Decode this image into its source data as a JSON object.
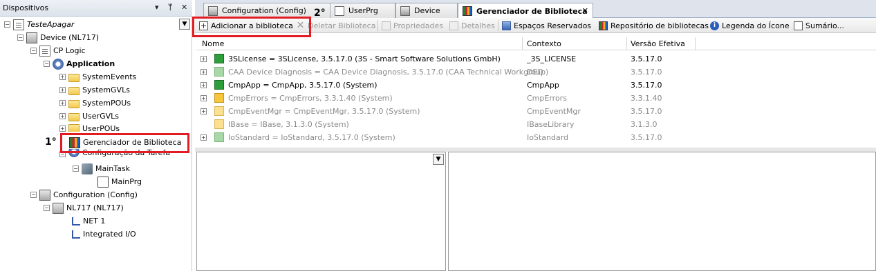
{
  "left_panel": {
    "title": "Dispositivos",
    "pin_label": "▾",
    "pin2_label": "ᛘ",
    "close_label": "✕",
    "tree": [
      {
        "label": "TesteApagar",
        "italic": true
      },
      {
        "label": "Device (NL717)"
      },
      {
        "label": "CP Logic"
      },
      {
        "label": "Application",
        "bold": true
      },
      {
        "label": "SystemEvents"
      },
      {
        "label": "SystemGVLs"
      },
      {
        "label": "SystemPOUs"
      },
      {
        "label": "UserGVLs"
      },
      {
        "label": "UserPOUs"
      },
      {
        "label": "Gerenciador de Biblioteca"
      },
      {
        "label": "Configuração da Tarefa"
      },
      {
        "label": "MainTask"
      },
      {
        "label": "MainPrg"
      },
      {
        "label": "Configuration (Config)"
      },
      {
        "label": "NL717 (NL717)"
      },
      {
        "label": "NET 1"
      },
      {
        "label": "Integrated I/O"
      }
    ],
    "step_label": "1°"
  },
  "tabs": [
    {
      "label": "Configuration (Config)"
    },
    {
      "label": "UserPrg"
    },
    {
      "label": "Device"
    },
    {
      "label": "Gerenciador de Biblioteca",
      "active": true,
      "close": "✕"
    }
  ],
  "step2_label": "2°",
  "toolbar": {
    "add_library": "Adicionar a biblioteca",
    "delete_library": "Deletar Biblioteca",
    "properties": "Propriedades",
    "details": "Detalhes",
    "placeholders": "Espaços Reservados",
    "library_repository": "Repositório de bibliotecas",
    "icon_legend": "Legenda do Ícone",
    "summary": "Sumário..."
  },
  "library_table": {
    "columns": [
      "Nome",
      "Contexto",
      "Versão Efetiva"
    ],
    "rows": [
      {
        "name": "3SLicense = 3SLicense, 3.5.17.0 (3S - Smart Software Solutions GmbH)",
        "context": "_3S_LICENSE",
        "version": "3.5.17.0",
        "icon": "green",
        "gray": false,
        "expandable": true
      },
      {
        "name": "CAA Device Diagnosis = CAA Device Diagnosis, 3.5.17.0 (CAA Technical Workgroup)",
        "context": "DED",
        "version": "3.5.17.0",
        "icon": "green-light",
        "gray": true,
        "expandable": true
      },
      {
        "name": "CmpApp = CmpApp, 3.5.17.0 (System)",
        "context": "CmpApp",
        "version": "3.5.17.0",
        "icon": "green",
        "gray": false,
        "expandable": true
      },
      {
        "name": "CmpErrors = CmpErrors, 3.3.1.40 (System)",
        "context": "CmpErrors",
        "version": "3.3.1.40",
        "icon": "yellow",
        "gray": true,
        "expandable": true
      },
      {
        "name": "CmpEventMgr = CmpEventMgr, 3.5.17.0 (System)",
        "context": "CmpEventMgr",
        "version": "3.5.17.0",
        "icon": "yellow-light",
        "gray": true,
        "expandable": true
      },
      {
        "name": "IBase = IBase, 3.1.3.0 (System)",
        "context": "IBaseLibrary",
        "version": "3.1.3.0",
        "icon": "yellow-light",
        "gray": true,
        "expandable": false
      },
      {
        "name": "IoStandard = IoStandard, 3.5.17.0 (System)",
        "context": "IoStandard",
        "version": "3.5.17.0",
        "icon": "green-light",
        "gray": true,
        "expandable": true
      }
    ]
  },
  "dropdown_arrow": "▼",
  "expand_plus": "+",
  "expand_minus": "−",
  "info_symbol": "i"
}
